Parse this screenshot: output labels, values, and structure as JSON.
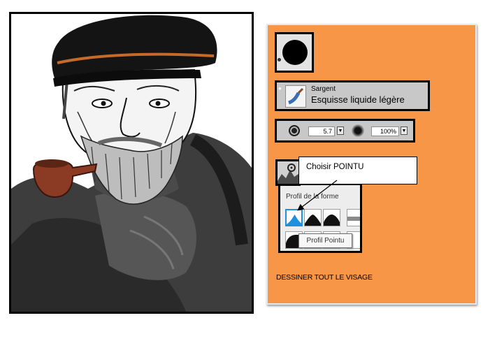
{
  "portrait": {
    "description_icon": "sailor-portrait-image"
  },
  "brush": {
    "category": "Sargent",
    "variant": "Esquisse liquide légère",
    "size_value": "5.7",
    "opacity_value": "100%"
  },
  "profile": {
    "panel_label": "Profil de la forme",
    "tooltip": "Profil Pointu"
  },
  "callout": {
    "text": "Choisir POINTU"
  },
  "instruction": {
    "text": "DESSINER TOUT LE VISAGE"
  },
  "colors": {
    "panel": "#f79646",
    "selected_tile": "#1f8fe0"
  }
}
